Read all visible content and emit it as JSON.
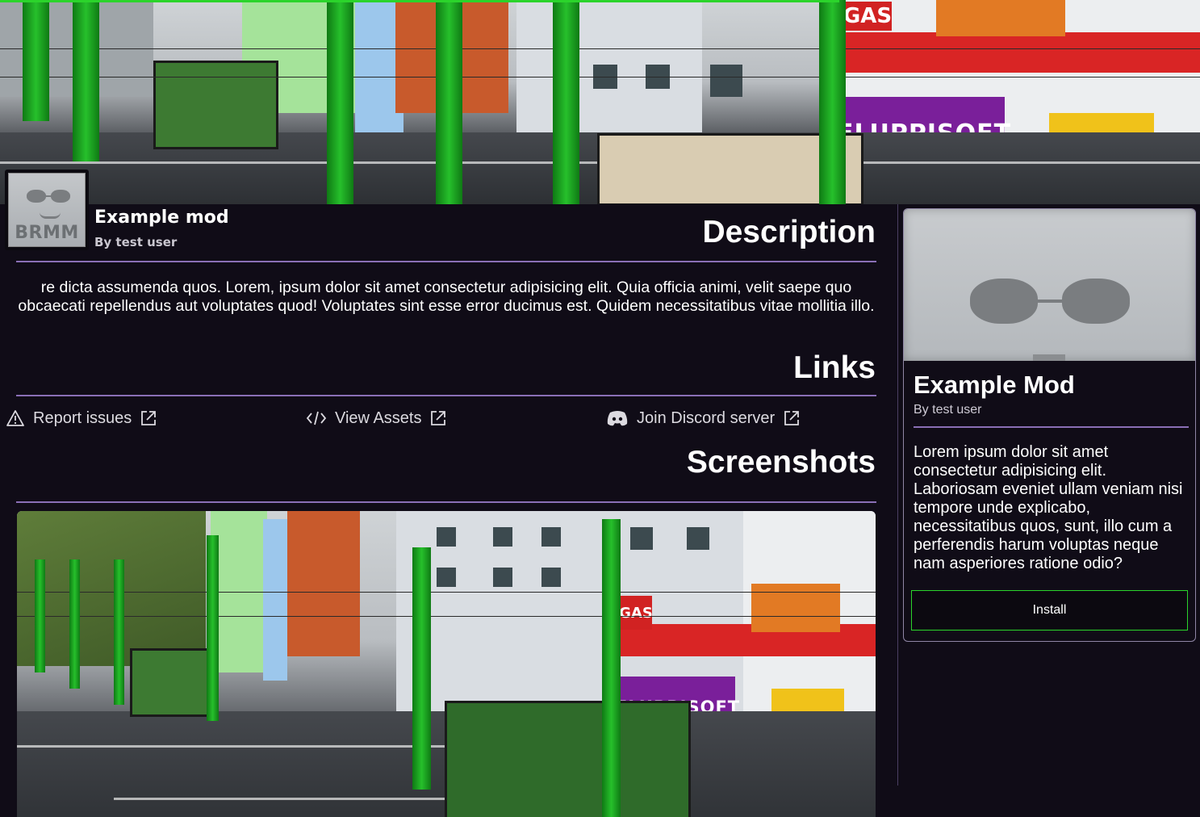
{
  "banner": {
    "billboard_text": "FLUPPISOFT",
    "gas_sign": "GAS"
  },
  "mod": {
    "thumb_label": "BRMM",
    "title": "Example mod",
    "author": "By test user"
  },
  "description": {
    "heading": "Description",
    "text": "re dicta assumenda quos. Lorem, ipsum dolor sit amet consectetur adipisicing elit. Quia officia animi, velit saepe quo obcaecati repellendus aut voluptates quod! Voluptates sint esse error ducimus est. Quidem necessitatibus vitae mollitia illo."
  },
  "links": {
    "heading": "Links",
    "items": [
      {
        "label": "Report issues",
        "icon": "warning-icon"
      },
      {
        "label": "View Assets",
        "icon": "code-icon"
      },
      {
        "label": "Join Discord server",
        "icon": "discord-icon"
      }
    ]
  },
  "screenshots": {
    "heading": "Screenshots",
    "billboard_text": "FLUPPISOFT",
    "gas_sign": "GAS"
  },
  "card": {
    "title": "Example Mod",
    "author": "By test user",
    "description": "Lorem ipsum dolor sit amet consectetur adipisicing elit. Laboriosam eveniet ullam veniam nisi tempore unde explicabo, necessitatibus quos, sunt, illo cum a perferendis harum voluptas neque nam asperiores ratione odio?",
    "install_label": "Install"
  },
  "colors": {
    "background": "#100c17",
    "accent_rule": "#8a6fb6",
    "install_border": "#2bd42b"
  }
}
